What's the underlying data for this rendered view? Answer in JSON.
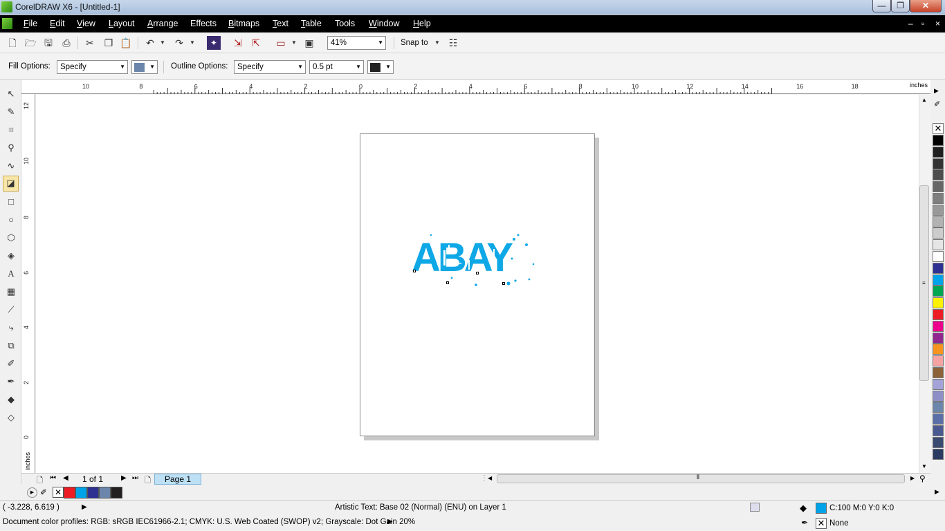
{
  "window": {
    "title": "CorelDRAW X6 - [Untitled-1]",
    "min": "—",
    "max": "❐",
    "close": "✕"
  },
  "menu": {
    "items": [
      {
        "u": "F",
        "rest": "ile"
      },
      {
        "u": "E",
        "rest": "dit"
      },
      {
        "u": "V",
        "rest": "iew"
      },
      {
        "u": "L",
        "rest": "ayout"
      },
      {
        "u": "A",
        "rest": "rrange"
      },
      {
        "u": "",
        "rest": "Effects"
      },
      {
        "u": "B",
        "rest": "itmaps"
      },
      {
        "u": "T",
        "rest": "ext"
      },
      {
        "u": "T",
        "rest": "able"
      },
      {
        "u": "",
        "rest": "Tools"
      },
      {
        "u": "W",
        "rest": "indow"
      },
      {
        "u": "H",
        "rest": "elp"
      }
    ],
    "mdi_min": "–",
    "mdi_restore": "▫",
    "mdi_close": "×"
  },
  "standard_toolbar": {
    "zoom_value": "41%",
    "snap_to": "Snap to"
  },
  "property_bar": {
    "fill_label": "Fill Options:",
    "fill_value": "Specify",
    "fill_color": "#6b86aa",
    "outline_label": "Outline Options:",
    "outline_value": "Specify",
    "outline_width": "0.5 pt",
    "outline_color": "#222222"
  },
  "rulers": {
    "unit": "inches",
    "h_labels": [
      "10",
      "8",
      "6",
      "4",
      "2",
      "0",
      "2",
      "4",
      "6",
      "8",
      "10",
      "12",
      "14",
      "16",
      "18"
    ],
    "v_labels": [
      "12",
      "10",
      "8",
      "6",
      "4",
      "2",
      "0"
    ]
  },
  "artwork": {
    "text": "ABAY",
    "color": "#0fa8e6"
  },
  "navigator": {
    "page_count": "1 of 1",
    "page_tab": "Page 1"
  },
  "document_palette": [
    "#ed1c24",
    "#00a3e8",
    "#2e3192",
    "#6b86aa",
    "#231f20"
  ],
  "color_palette": [
    "#000000",
    "#1f1f1f",
    "#333333",
    "#4c4c4c",
    "#666666",
    "#7f7f7f",
    "#999999",
    "#b2b2b2",
    "#cccccc",
    "#e5e5e5",
    "#ffffff",
    "#2e3192",
    "#00a3e8",
    "#00a651",
    "#fff200",
    "#ed1c24",
    "#ec008c",
    "#92278f",
    "#f7941d",
    "#f5a3a3",
    "#8c6239",
    "#a3a3d9",
    "#8e8fc7",
    "#6b86aa",
    "#5a6ea8",
    "#4a5a90",
    "#3a4a70",
    "#2a3a60"
  ],
  "status": {
    "coords": "( -3.228, 6.619 )",
    "object_info": "Artistic Text: Base 02 (Normal) (ENU) on Layer 1",
    "fill_swatch": "#00a3e8",
    "fill_info": "C:100 M:0 Y:0 K:0",
    "outline_info": "None",
    "profiles": "Document color profiles: RGB: sRGB IEC61966-2.1; CMYK: U.S. Web Coated (SWOP) v2; Grayscale: Dot Gain 20%"
  }
}
